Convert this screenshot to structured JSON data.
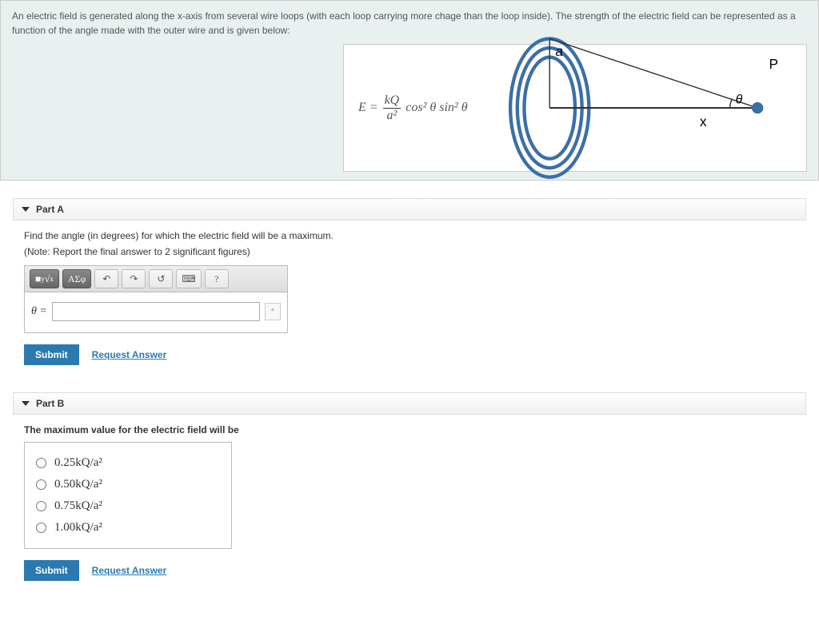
{
  "intro": "An electric field is generated along the x-axis from several wire loops (with each loop carrying more chage than the loop inside). The strength of the electric field can be represented as a function of the angle made with the outer wire and is given below:",
  "equation": {
    "lhs": "E =",
    "frac_num": "kQ",
    "frac_den": "a²",
    "rhs": "cos² θ sin² θ"
  },
  "diagram": {
    "a_label": "a",
    "p_label": "P",
    "theta_label": "θ",
    "x_label": "x"
  },
  "partA": {
    "title": "Part A",
    "prompt": "Find the angle (in degrees) for which the electric field will be a maximum.",
    "note": "(Note: Report the final answer to 2 significant figures)",
    "toolbar": {
      "templates_label": "x√y",
      "greek_label": "ΑΣφ",
      "undo_label": "↶",
      "redo_label": "↷",
      "reset_label": "↺",
      "keyboard_label": "⌨",
      "help_label": "?"
    },
    "theta_label": "θ =",
    "unit_label": "∘",
    "submit": "Submit",
    "request": "Request Answer"
  },
  "partB": {
    "title": "Part B",
    "prompt": "The maximum value for the electric field will be",
    "options": [
      "0.25kQ/a²",
      "0.50kQ/a²",
      "0.75kQ/a²",
      "1.00kQ/a²"
    ],
    "submit": "Submit",
    "request": "Request Answer"
  }
}
